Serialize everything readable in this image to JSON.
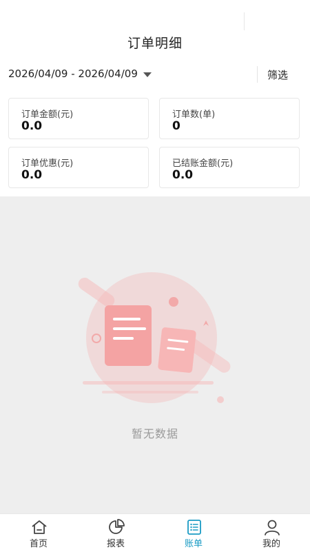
{
  "header": {
    "title": "订单明细"
  },
  "filter": {
    "date_range": "2026/04/09 - 2026/04/09",
    "filter_label": "筛选"
  },
  "stats": [
    {
      "label": "订单金额(元)",
      "value": "0.0"
    },
    {
      "label": "订单数(单)",
      "value": "0"
    },
    {
      "label": "订单优惠(元)",
      "value": "0.0"
    },
    {
      "label": "已结账金额(元)",
      "value": "0.0"
    }
  ],
  "empty": {
    "text": "暂无数据"
  },
  "tabs": [
    {
      "label": "首页",
      "icon": "home-icon"
    },
    {
      "label": "报表",
      "icon": "pie-chart-icon"
    },
    {
      "label": "账单",
      "icon": "list-icon",
      "active": true
    },
    {
      "label": "我的",
      "icon": "user-icon"
    }
  ],
  "colors": {
    "accent": "#1a9bc4",
    "empty_bg": "#eeeeee",
    "illustration": "#f4a3a3"
  }
}
